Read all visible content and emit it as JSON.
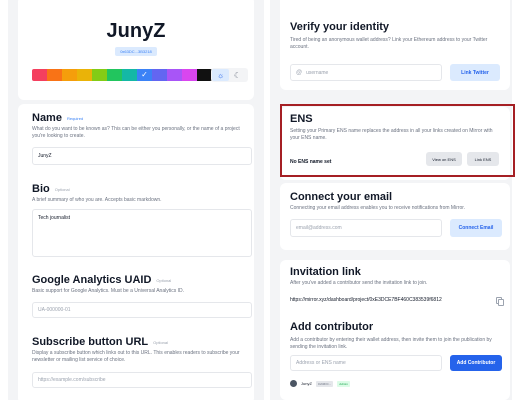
{
  "profile": {
    "name": "JunyZ",
    "address": "0x63DC...3B3218",
    "colors": [
      "#f43f5e",
      "#f97316",
      "#f59e0b",
      "#eab308",
      "#84cc16",
      "#22c55e",
      "#14b8a6",
      "#3b82f6",
      "#6366f1",
      "#a855f7",
      "#d946ef",
      "#111111"
    ],
    "selected_color_index": 7,
    "theme": "light",
    "theme_icons": [
      "sun-icon",
      "moon-icon"
    ]
  },
  "fields": {
    "name": {
      "title": "Name",
      "tag": "Required",
      "description": "What do you want to be known as? This can be either you personally, or the name of a project you're looking to create.",
      "value": "JunyZ"
    },
    "bio": {
      "title": "Bio",
      "tag": "Optional",
      "description": "A brief summary of who you are. Accepts basic markdown.",
      "value": "Tech journalist"
    },
    "ga": {
      "title": "Google Analytics UAID",
      "tag": "Optional",
      "description": "Basic support for Google Analytics. Must be a Universal Analytics ID.",
      "placeholder": "UA-000000-01"
    },
    "subscribe": {
      "title": "Subscribe button URL",
      "tag": "Optional",
      "description": "Display a subscribe button which links out to this URL. This enables readers to subscribe your newsletter or mailing list service of choice.",
      "placeholder": "https://example.com/subscribe"
    }
  },
  "verify": {
    "title": "Verify your identity",
    "description": "Tired of being an anonymous wallet address? Link your Ethereum address to your Twitter account.",
    "placeholder": "username",
    "button": "Link Twitter"
  },
  "ens": {
    "title": "ENS",
    "description": "Setting your Primary ENS name replaces the address in all your links created on Mirror with your ENS name.",
    "status": "No ENS name set",
    "view_button": "View on ENS",
    "link_button": "Link ENS"
  },
  "email": {
    "title": "Connect your email",
    "description": "Connecting your email address enables you to receive notifications from Mirror.",
    "placeholder": "email@address.com",
    "button": "Connect Email"
  },
  "invitation": {
    "title": "Invitation link",
    "description": "After you've added a contributor send the invitation link to join.",
    "url": "https://mirror.xyz/dashboard/project/0xE3DCE7BF460C383539f6812"
  },
  "contributor": {
    "title": "Add contributor",
    "description": "Add a contributor by entering their wallet address, then invite them to join the publication by sending the invitation link.",
    "placeholder": "Address or ENS name",
    "button": "Add Contributor",
    "entry": {
      "name": "JunyZ",
      "address": "0x63DC...",
      "role": "Admin"
    }
  }
}
